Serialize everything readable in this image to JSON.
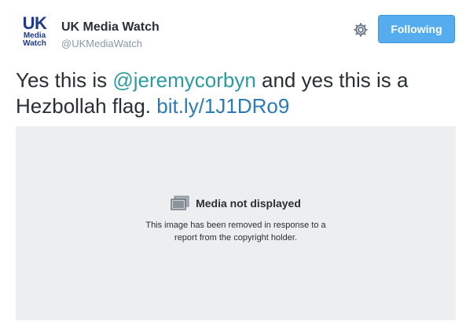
{
  "author": {
    "avatar_line1": "UK",
    "avatar_line2": "Media",
    "avatar_line3": "Watch",
    "name": "UK Media Watch",
    "handle": "@UKMediaWatch"
  },
  "actions": {
    "settings_icon": "gear-icon",
    "follow_label": "Following"
  },
  "tweet": {
    "text_part1": "Yes this is ",
    "mention": "@jeremycorbyn",
    "text_part2": " and yes this is a Hezbollah flag. ",
    "link": "bit.ly/1J1DRo9"
  },
  "media": {
    "icon": "media-withheld-icon",
    "title": "Media not displayed",
    "desc_line1": "This image has been removed in response to a",
    "desc_line2": "report from the copyright holder."
  },
  "colors": {
    "brand_blue": "#55acee",
    "mention": "#2b9ba0",
    "link": "#2b7bb9",
    "placeholder_bg": "#eceef0"
  }
}
